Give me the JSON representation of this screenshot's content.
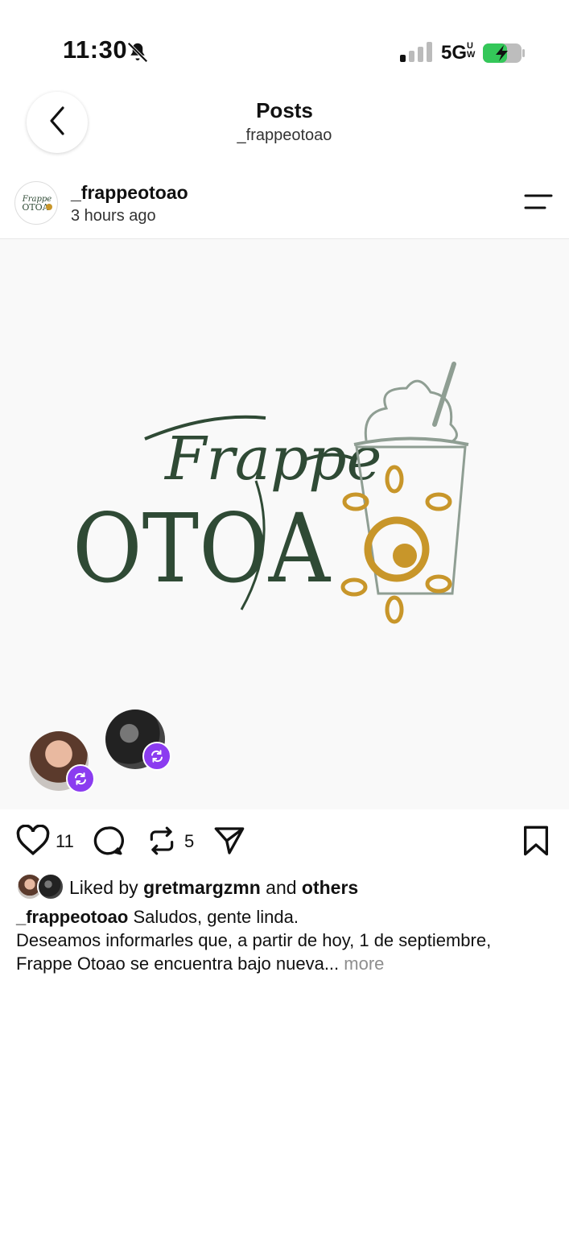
{
  "status_bar": {
    "time": "11:30",
    "network": "5G",
    "network_suffix": "UW",
    "icons": [
      "bell-slash-icon",
      "signal-icon",
      "battery-charging-icon"
    ]
  },
  "header": {
    "title": "Posts",
    "subtitle": "_frappeotoao",
    "back_icon": "chevron-left-icon"
  },
  "post": {
    "username": "_frappeotoao",
    "time_ago": "3 hours ago",
    "avatar_text_top": "Frappe",
    "avatar_text_bottom": "OTOA",
    "menu_icon": "menu-icon",
    "image": {
      "logo_script": "Frappe",
      "logo_main": "OTOA",
      "colors": {
        "green": "#2f4a35",
        "gold": "#c8962a",
        "cup": "#8f9e93"
      }
    },
    "reposters": [
      "avatar-woman",
      "avatar-dark"
    ],
    "actions": {
      "likes": "11",
      "reposts": "5",
      "icons": [
        "heart-icon",
        "comment-icon",
        "repost-icon",
        "send-icon",
        "bookmark-icon"
      ]
    },
    "liked_by": {
      "prefix": "Liked by",
      "user": "gretmargzmn",
      "and": "and",
      "others": "others"
    },
    "caption": {
      "author": "_frappeotoao",
      "line1": "Saludos, gente linda.",
      "line2": "Deseamos informarles que, a partir de hoy, 1 de septiembre,",
      "line3": "Frappe Otoao se encuentra bajo nueva...",
      "more": "more"
    }
  },
  "colors": {
    "repost_badge": "#8b3cf0",
    "muted": "#8e8e8e"
  }
}
